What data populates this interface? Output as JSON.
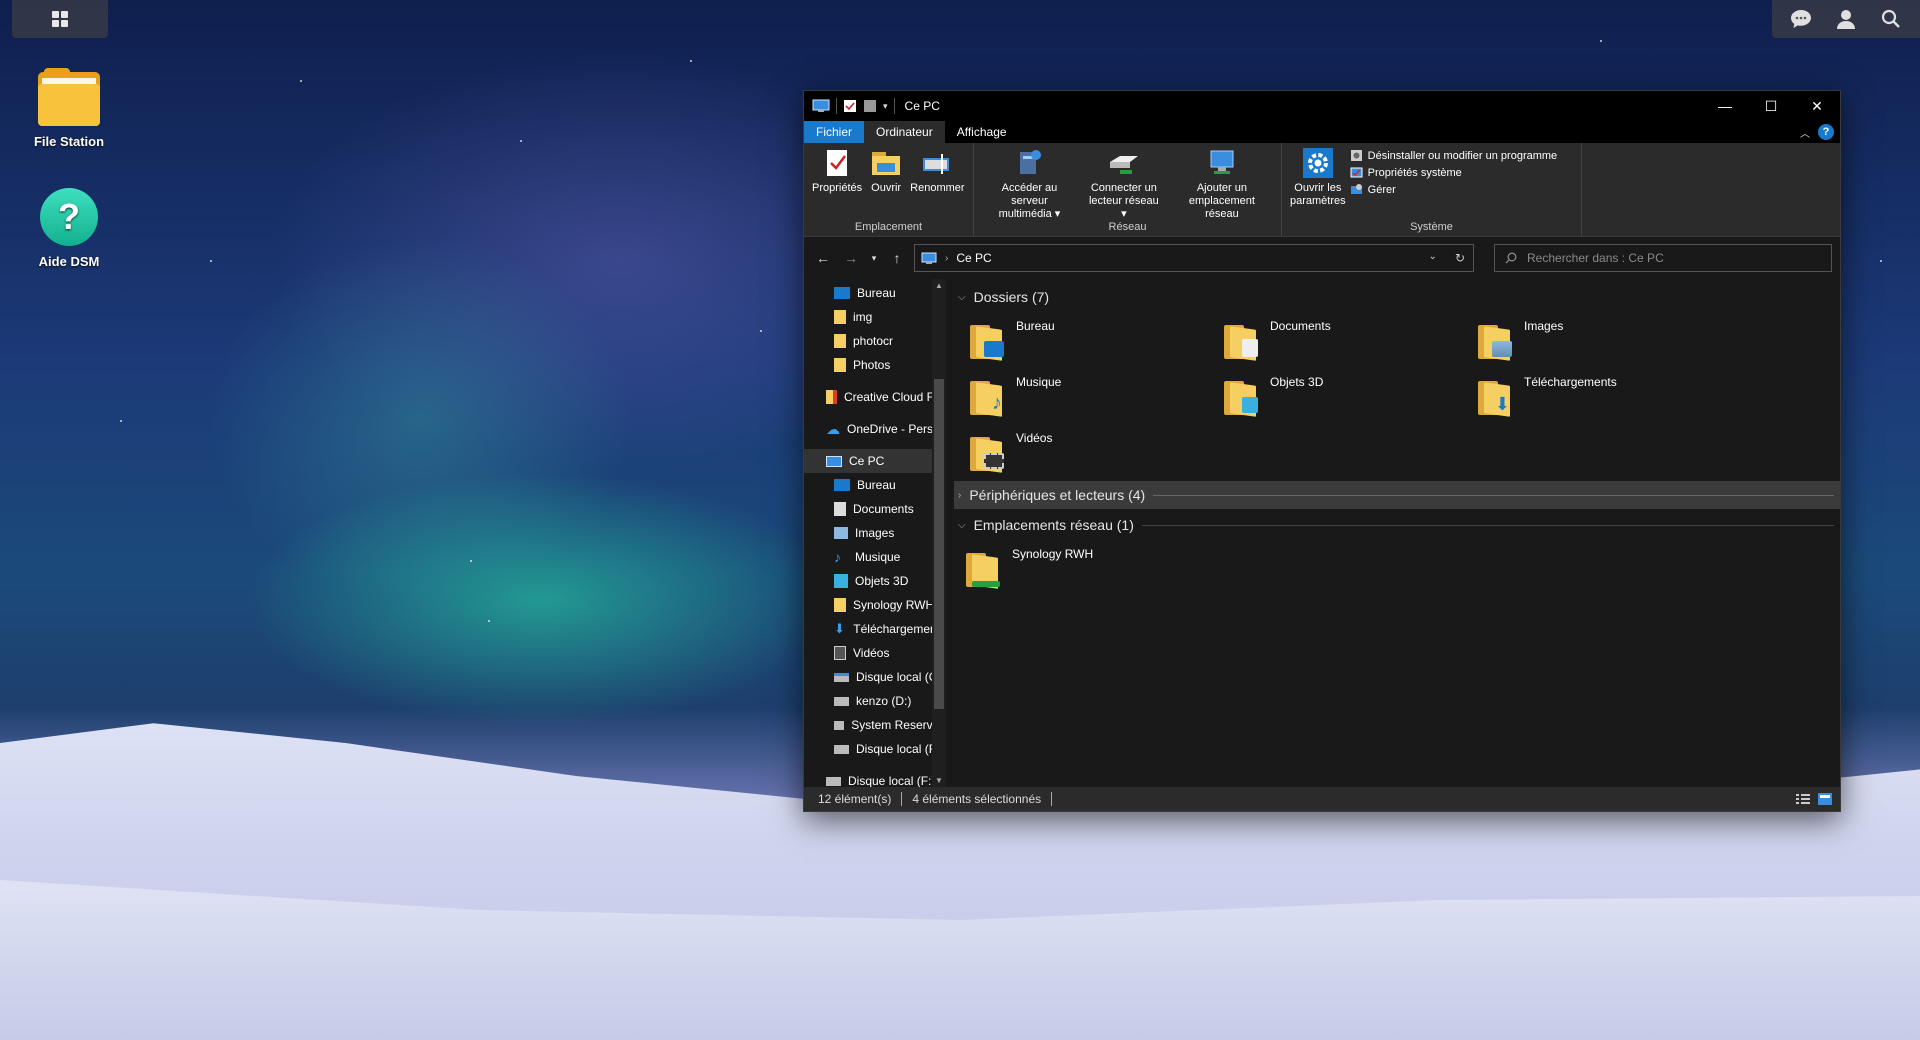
{
  "desktop": {
    "icons": [
      {
        "label": "File Station"
      },
      {
        "label": "Aide DSM"
      }
    ]
  },
  "window": {
    "title": "Ce PC",
    "controls": [
      "—",
      "☐",
      "✕"
    ],
    "tabs": {
      "file": "Fichier",
      "computer": "Ordinateur",
      "view": "Affichage"
    },
    "help": "?",
    "ribbon": {
      "location": {
        "label": "Emplacement",
        "properties": "Propriétés",
        "open": "Ouvrir",
        "rename": "Renommer"
      },
      "network": {
        "label": "Réseau",
        "media_server_1": "Accéder au serveur",
        "media_server_2": "multimédia ▾",
        "map_drive_1": "Connecter un",
        "map_drive_2": "lecteur réseau ▾",
        "add_location_1": "Ajouter un",
        "add_location_2": "emplacement réseau"
      },
      "system": {
        "label": "Système",
        "open_settings_1": "Ouvrir les",
        "open_settings_2": "paramètres",
        "uninstall": "Désinstaller ou modifier un programme",
        "system_properties": "Propriétés système",
        "manage": "Gérer"
      }
    },
    "address": {
      "path": "Ce PC",
      "search_placeholder": "Rechercher dans : Ce PC"
    },
    "nav": {
      "quick": [
        "Bureau",
        "img",
        "photocr",
        "Photos"
      ],
      "creative_cloud": "Creative Cloud File",
      "onedrive": "OneDrive - Person",
      "this_pc": "Ce PC",
      "pc_items": [
        "Bureau",
        "Documents",
        "Images",
        "Musique",
        "Objets 3D",
        "Synology RWH",
        "Téléchargements",
        "Vidéos",
        "Disque local (C:)",
        "kenzo (D:)",
        "System Reserved",
        "Disque local (F:)"
      ],
      "drive_f": "Disque local (F:)"
    },
    "content": {
      "folders_header": "Dossiers (7)",
      "folders": [
        "Bureau",
        "Documents",
        "Images",
        "Musique",
        "Objets 3D",
        "Téléchargements",
        "Vidéos"
      ],
      "devices_header": "Périphériques et lecteurs (4)",
      "network_header": "Emplacements réseau (1)",
      "network_items": [
        "Synology RWH"
      ]
    },
    "status": {
      "count": "12 élément(s)",
      "selected": "4 éléments sélectionnés"
    }
  },
  "colors": {
    "accent": "#1979ca",
    "window_bg": "#191919",
    "ribbon_bg": "#2b2b2b",
    "folder_yellow": "#f6cf62"
  }
}
